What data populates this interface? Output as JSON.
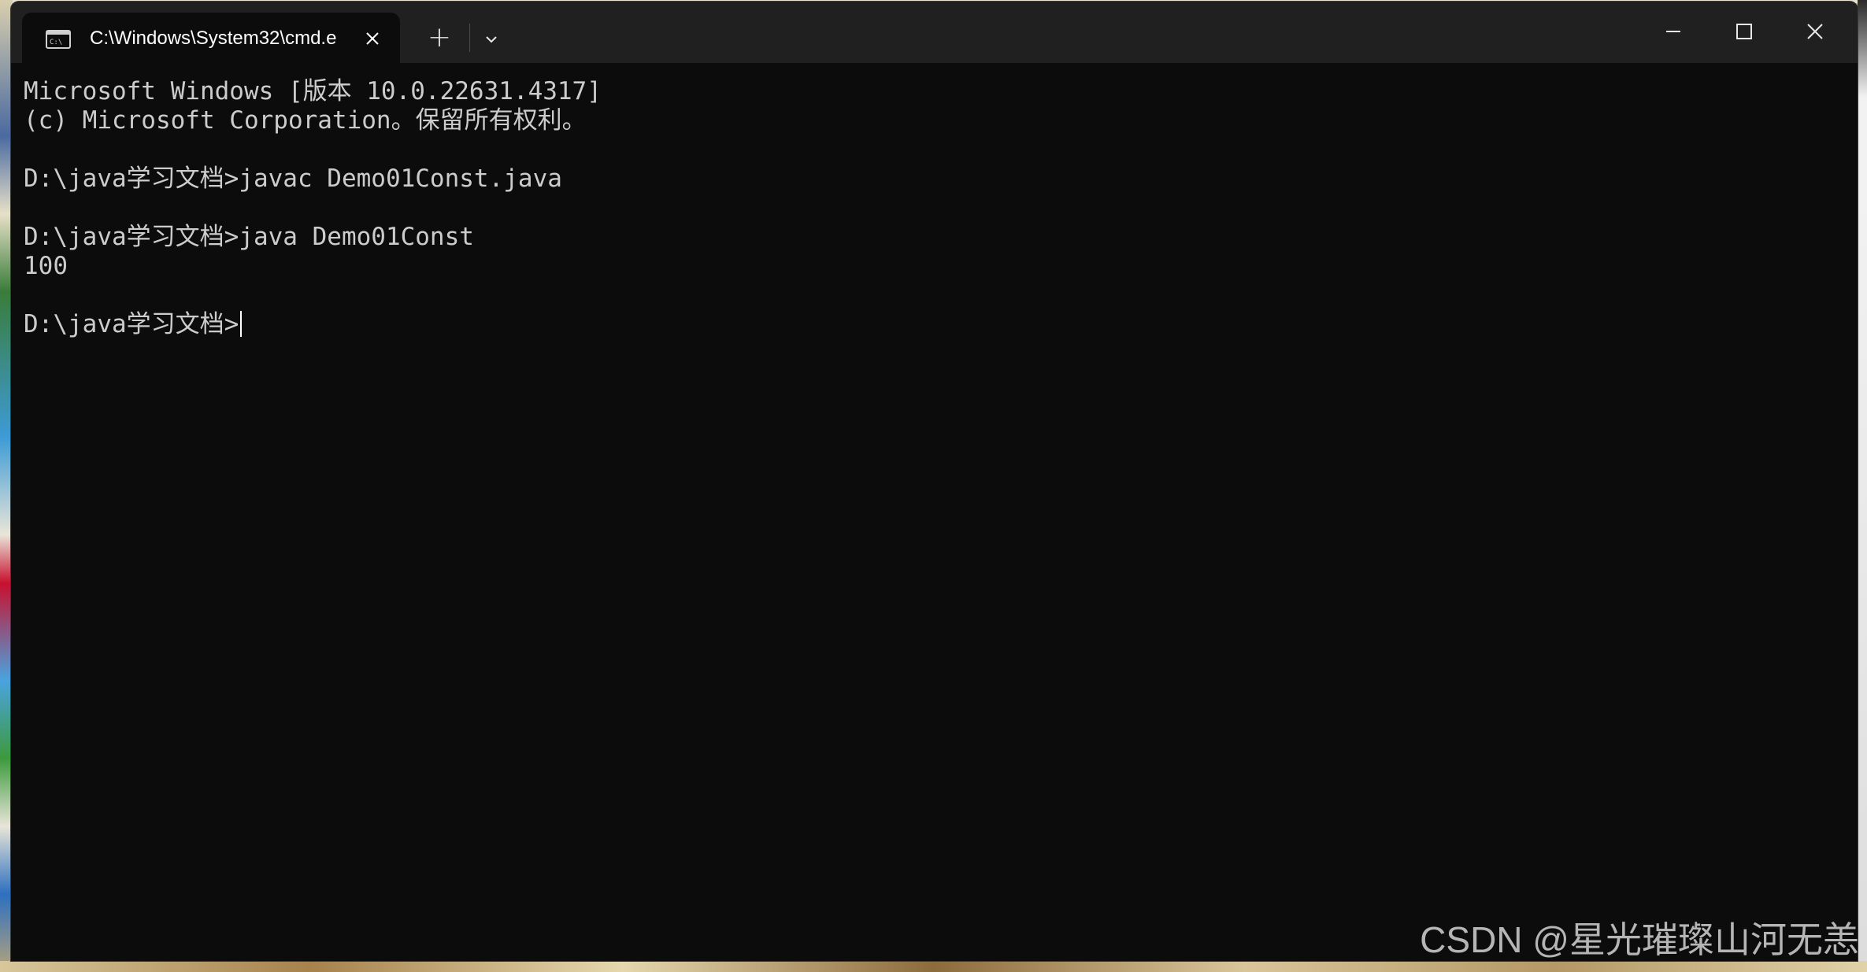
{
  "window": {
    "tab_title": "C:\\Windows\\System32\\cmd.e",
    "tab_icon": "console-icon",
    "close_tab_icon": "close-icon",
    "new_tab_label": "+",
    "dropdown_icon": "chevron-down-icon",
    "minimize_icon": "minimize-icon",
    "maximize_icon": "maximize-icon",
    "close_window_icon": "close-icon"
  },
  "console": {
    "lines": [
      "Microsoft Windows [版本 10.0.22631.4317]",
      "(c) Microsoft Corporation。保留所有权利。",
      "",
      "D:\\java学习文档>javac Demo01Const.java",
      "",
      "D:\\java学习文档>java Demo01Const",
      "100",
      "",
      "D:\\java学习文档>"
    ]
  },
  "watermark": "CSDN @星光璀璨山河无恙",
  "colors": {
    "console_bg": "#0c0c0c",
    "console_text": "#cccccc",
    "titlebar_bg": "#202020"
  }
}
